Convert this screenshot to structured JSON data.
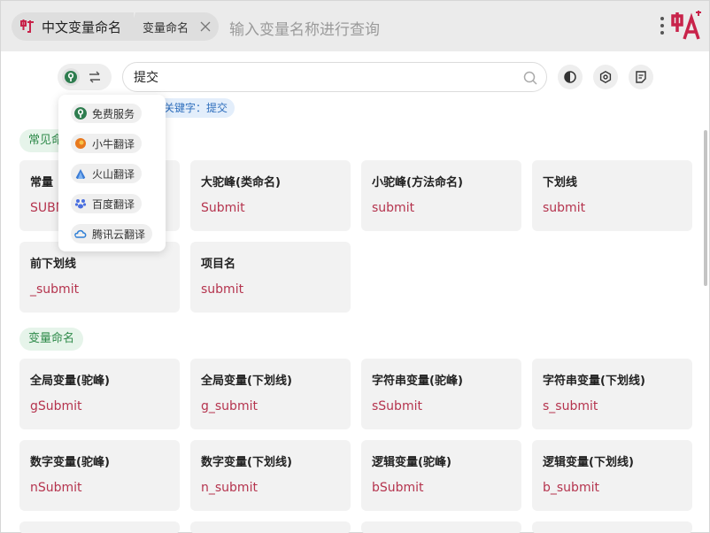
{
  "header": {
    "app_tab_label": "中文变量命名",
    "sub_tab_label": "变量命名",
    "search_placeholder": "输入变量名称进行查询"
  },
  "toolbar": {
    "search_value": "提交",
    "keyword_chip": "关键字：提交"
  },
  "translators": [
    {
      "label": "免费服务",
      "icon": "free-service-icon",
      "color": "#2e7d4f"
    },
    {
      "label": "小牛翻译",
      "icon": "niutrans-icon",
      "color": "#e8791e"
    },
    {
      "label": "火山翻译",
      "icon": "volcano-icon",
      "color": "#3a7bd5"
    },
    {
      "label": "百度翻译",
      "icon": "baidu-icon",
      "color": "#4a6fe0"
    },
    {
      "label": "腾讯云翻译",
      "icon": "tencent-cloud-icon",
      "color": "#2f7fd6"
    }
  ],
  "sections": [
    {
      "title": "常见命名",
      "cards": [
        {
          "title": "常量",
          "value": "SUBMIT"
        },
        {
          "title": "大驼峰(类命名)",
          "value": "Submit"
        },
        {
          "title": "小驼峰(方法命名)",
          "value": "submit"
        },
        {
          "title": "下划线",
          "value": "submit"
        },
        {
          "title": "前下划线",
          "value": "_submit"
        },
        {
          "title": "项目名",
          "value": "submit"
        }
      ]
    },
    {
      "title": "变量命名",
      "cards": [
        {
          "title": "全局变量(驼峰)",
          "value": "gSubmit"
        },
        {
          "title": "全局变量(下划线)",
          "value": "g_submit"
        },
        {
          "title": "字符串变量(驼峰)",
          "value": "sSubmit"
        },
        {
          "title": "字符串变量(下划线)",
          "value": "s_submit"
        },
        {
          "title": "数字变量(驼峰)",
          "value": "nSubmit"
        },
        {
          "title": "数字变量(下划线)",
          "value": "n_submit"
        },
        {
          "title": "逻辑变量(驼峰)",
          "value": "bSubmit"
        },
        {
          "title": "逻辑变量(下划线)",
          "value": "b_submit"
        }
      ]
    }
  ],
  "colors": {
    "accent_value": "#b5344e",
    "section_green": "#2e8a4a",
    "keyword_blue": "#2f6fbd"
  }
}
